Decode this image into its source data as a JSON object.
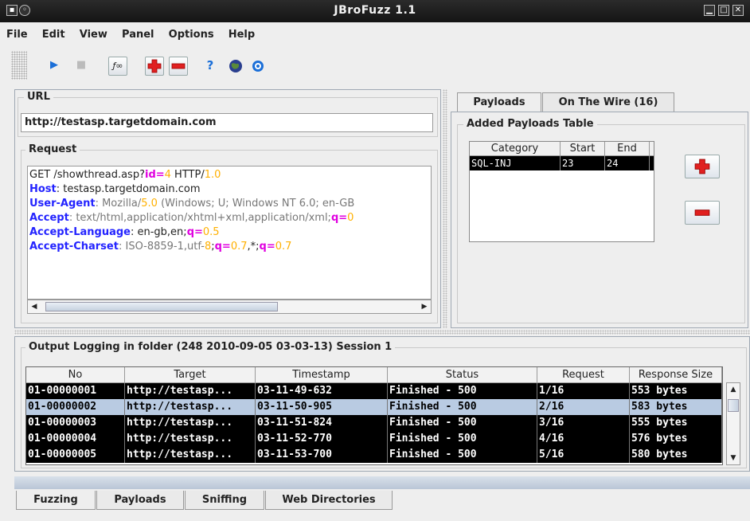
{
  "window": {
    "title": "JBroFuzz 1.1"
  },
  "menu": [
    "File",
    "Edit",
    "View",
    "Panel",
    "Options",
    "Help"
  ],
  "toolbar": {
    "icons": [
      "play-icon",
      "stop-icon",
      "function-icon",
      "add-icon",
      "remove-icon",
      "help-icon",
      "globe-icon",
      "target-icon"
    ],
    "play_glyph": "▶",
    "stop_glyph": "■",
    "function_glyph": "ƒ∞",
    "help_glyph": "?"
  },
  "url_panel": {
    "label": "URL",
    "value": "http://testasp.targetdomain.com"
  },
  "request_panel": {
    "label": "Request",
    "lines": [
      [
        "GET /showthread.asp?",
        "id=",
        "4",
        " HTTP/",
        "1.0"
      ],
      [
        "Host",
        ": testasp.targetdomain.com"
      ],
      [
        "User-Agent",
        ": Mozilla/",
        "5.0",
        " (Windows; U; Windows NT 6.0; en-GB"
      ],
      [
        "Accept",
        ": text/html,application/xhtml+xml,application/xml;",
        "q=",
        "0"
      ],
      [
        "Accept-Language",
        ": en-gb,en;",
        "q=",
        "0.5"
      ],
      [
        "Accept-Charset",
        ": ISO-8859-1,utf-",
        "8",
        ";",
        "q=",
        "0.7",
        ",*;",
        "q=",
        "0.7"
      ]
    ]
  },
  "right_tabs": [
    "Payloads",
    "On The Wire (16)"
  ],
  "payloads": {
    "group_label": "Added Payloads Table",
    "columns": [
      "Category",
      "Start",
      "End"
    ],
    "rows": [
      [
        "SQL-INJ",
        "23",
        "24"
      ]
    ]
  },
  "output": {
    "label": "Output  Logging in folder (248 2010-09-05 03-03-13) Session 1",
    "columns": [
      "No",
      "Target",
      "Timestamp",
      "Status",
      "Request",
      "Response Size"
    ],
    "rows": [
      [
        "01-00000001",
        "http://testasp...",
        "03-11-49-632",
        "Finished - 500",
        "1/16",
        "553 bytes"
      ],
      [
        "01-00000002",
        "http://testasp...",
        "03-11-50-905",
        "Finished - 500",
        "2/16",
        "583 bytes"
      ],
      [
        "01-00000003",
        "http://testasp...",
        "03-11-51-824",
        "Finished - 500",
        "3/16",
        "555 bytes"
      ],
      [
        "01-00000004",
        "http://testasp...",
        "03-11-52-770",
        "Finished - 500",
        "4/16",
        "576 bytes"
      ],
      [
        "01-00000005",
        "http://testasp...",
        "03-11-53-700",
        "Finished - 500",
        "5/16",
        "580 bytes"
      ]
    ],
    "selected_row": 1
  },
  "bottom_tabs": [
    "Fuzzing",
    "Payloads",
    "Sniffing",
    "Web Directories"
  ],
  "colors": {
    "keyword": "#2323ff",
    "number": "#ffb000",
    "param": "#e000e0",
    "selection": "#b9cbe2"
  }
}
